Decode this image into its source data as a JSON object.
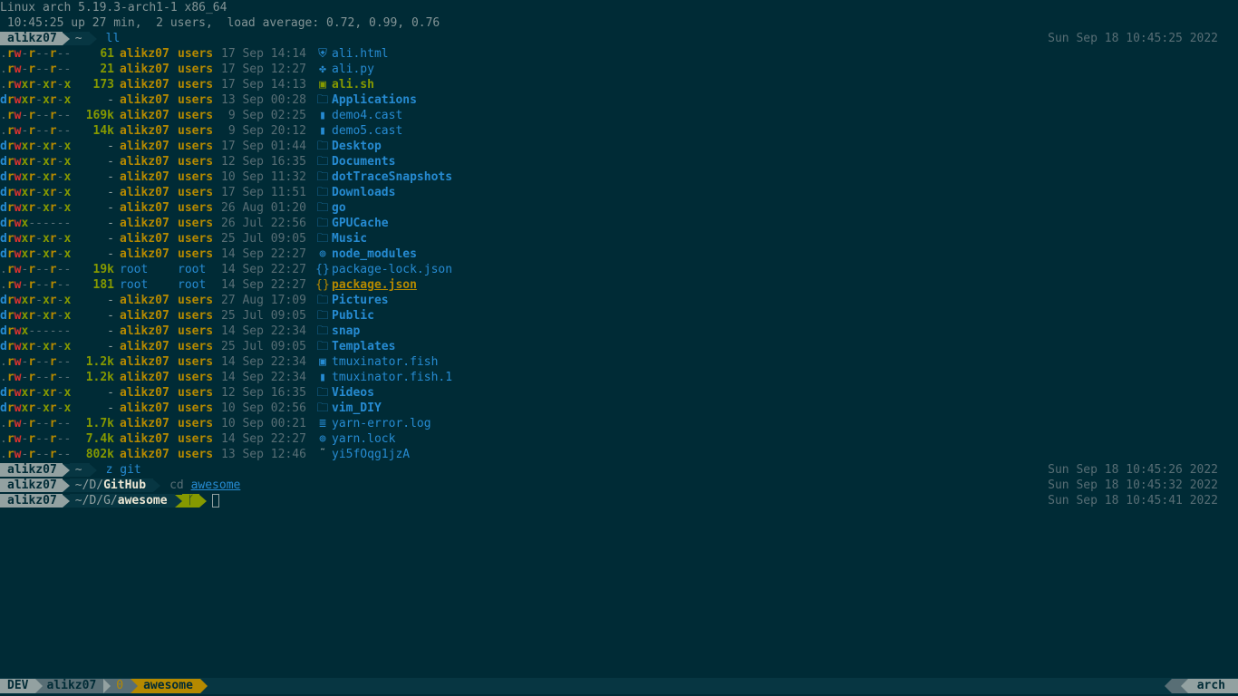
{
  "header": {
    "uname": "Linux arch 5.19.3-arch1-1 x86_64",
    "uptime": " 10:45:25 up 27 min,  2 users,  load average: 0.72, 0.99, 0.76"
  },
  "prompts": [
    {
      "user": "alikz07",
      "path_pre": "~",
      "path_bold": "",
      "command": "ll",
      "arg": "",
      "timestamp": "Sun Sep 18 10:45:25 2022"
    },
    {
      "user": "alikz07",
      "path_pre": "~",
      "path_bold": "",
      "command": "z git",
      "arg": "",
      "timestamp": "Sun Sep 18 10:45:26 2022"
    },
    {
      "user": "alikz07",
      "path_pre": "~/D/",
      "path_bold": "GitHub",
      "command": "cd",
      "arg": "awesome",
      "timestamp": "Sun Sep 18 10:45:32 2022"
    },
    {
      "user": "alikz07",
      "path_pre": "~/D/G/",
      "path_bold": "awesome",
      "command": "",
      "arg": "",
      "git_icon": "ᚴ",
      "timestamp": "Sun Sep 18 10:45:41 2022"
    }
  ],
  "files": [
    {
      "perm": ".rw-r--r--",
      "size": "61",
      "user": "alikz07",
      "group": "users",
      "date": "17 Sep 14:14",
      "icon": "html-icon",
      "glyph": "⛨",
      "name": "ali.html",
      "kind": "file"
    },
    {
      "perm": ".rw-r--r--",
      "size": "21",
      "user": "alikz07",
      "group": "users",
      "date": "17 Sep 12:27",
      "icon": "python-icon",
      "glyph": "✤",
      "name": "ali.py",
      "kind": "file"
    },
    {
      "perm": ".rwxr-xr-x",
      "size": "173",
      "user": "alikz07",
      "group": "users",
      "date": "17 Sep 14:13",
      "icon": "terminal-icon",
      "glyph": "▣",
      "name": "ali.sh",
      "kind": "exe"
    },
    {
      "perm": "drwxr-xr-x",
      "size": "-",
      "user": "alikz07",
      "group": "users",
      "date": "13 Sep 00:28",
      "icon": "folder-icon",
      "glyph": "🗀",
      "name": "Applications",
      "kind": "dir"
    },
    {
      "perm": ".rw-r--r--",
      "size": "169k",
      "user": "alikz07",
      "group": "users",
      "date": " 9 Sep 02:25",
      "icon": "file-icon",
      "glyph": "▮",
      "name": "demo4.cast",
      "kind": "file"
    },
    {
      "perm": ".rw-r--r--",
      "size": "14k",
      "user": "alikz07",
      "group": "users",
      "date": " 9 Sep 20:12",
      "icon": "file-icon",
      "glyph": "▮",
      "name": "demo5.cast",
      "kind": "file"
    },
    {
      "perm": "drwxr-xr-x",
      "size": "-",
      "user": "alikz07",
      "group": "users",
      "date": "17 Sep 01:44",
      "icon": "folder-icon",
      "glyph": "🗀",
      "name": "Desktop",
      "kind": "dir"
    },
    {
      "perm": "drwxr-xr-x",
      "size": "-",
      "user": "alikz07",
      "group": "users",
      "date": "12 Sep 16:35",
      "icon": "folder-icon",
      "glyph": "🗀",
      "name": "Documents",
      "kind": "dir"
    },
    {
      "perm": "drwxr-xr-x",
      "size": "-",
      "user": "alikz07",
      "group": "users",
      "date": "10 Sep 11:32",
      "icon": "folder-icon",
      "glyph": "🗀",
      "name": "dotTraceSnapshots",
      "kind": "dir"
    },
    {
      "perm": "drwxr-xr-x",
      "size": "-",
      "user": "alikz07",
      "group": "users",
      "date": "17 Sep 11:51",
      "icon": "folder-icon",
      "glyph": "🗀",
      "name": "Downloads",
      "kind": "dir"
    },
    {
      "perm": "drwxr-xr-x",
      "size": "-",
      "user": "alikz07",
      "group": "users",
      "date": "26 Aug 01:20",
      "icon": "folder-icon",
      "glyph": "🗀",
      "name": "go",
      "kind": "dir"
    },
    {
      "perm": "drwx------",
      "size": "-",
      "user": "alikz07",
      "group": "users",
      "date": "26 Jul 22:56",
      "icon": "folder-icon",
      "glyph": "🗀",
      "name": "GPUCache",
      "kind": "dir"
    },
    {
      "perm": "drwxr-xr-x",
      "size": "-",
      "user": "alikz07",
      "group": "users",
      "date": "25 Jul 09:05",
      "icon": "folder-icon",
      "glyph": "🗀",
      "name": "Music",
      "kind": "dir"
    },
    {
      "perm": "drwxr-xr-x",
      "size": "-",
      "user": "alikz07",
      "group": "users",
      "date": "14 Sep 22:27",
      "icon": "node-icon",
      "glyph": "⊚",
      "name": "node_modules",
      "kind": "dir"
    },
    {
      "perm": ".rw-r--r--",
      "size": "19k",
      "user": "root",
      "group": "root",
      "date": "14 Sep 22:27",
      "icon": "json-icon",
      "glyph": "{}",
      "name": "package-lock.json",
      "kind": "file"
    },
    {
      "perm": ".rw-r--r--",
      "size": "181",
      "user": "root",
      "group": "root",
      "date": "14 Sep 22:27",
      "icon": "json-icon",
      "glyph": "{}",
      "name": "package.json",
      "kind": "hl"
    },
    {
      "perm": "drwxr-xr-x",
      "size": "-",
      "user": "alikz07",
      "group": "users",
      "date": "27 Aug 17:09",
      "icon": "folder-icon",
      "glyph": "🗀",
      "name": "Pictures",
      "kind": "dir"
    },
    {
      "perm": "drwxr-xr-x",
      "size": "-",
      "user": "alikz07",
      "group": "users",
      "date": "25 Jul 09:05",
      "icon": "folder-icon",
      "glyph": "🗀",
      "name": "Public",
      "kind": "dir"
    },
    {
      "perm": "drwx------",
      "size": "-",
      "user": "alikz07",
      "group": "users",
      "date": "14 Sep 22:34",
      "icon": "folder-icon",
      "glyph": "🗀",
      "name": "snap",
      "kind": "dir"
    },
    {
      "perm": "drwxr-xr-x",
      "size": "-",
      "user": "alikz07",
      "group": "users",
      "date": "25 Jul 09:05",
      "icon": "folder-icon",
      "glyph": "🗀",
      "name": "Templates",
      "kind": "dir"
    },
    {
      "perm": ".rw-r--r--",
      "size": "1.2k",
      "user": "alikz07",
      "group": "users",
      "date": "14 Sep 22:34",
      "icon": "terminal-icon",
      "glyph": "▣",
      "name": "tmuxinator.fish",
      "kind": "file"
    },
    {
      "perm": ".rw-r--r--",
      "size": "1.2k",
      "user": "alikz07",
      "group": "users",
      "date": "14 Sep 22:34",
      "icon": "file-icon",
      "glyph": "▮",
      "name": "tmuxinator.fish.1",
      "kind": "file"
    },
    {
      "perm": "drwxr-xr-x",
      "size": "-",
      "user": "alikz07",
      "group": "users",
      "date": "12 Sep 16:35",
      "icon": "folder-icon",
      "glyph": "🗀",
      "name": "Videos",
      "kind": "dir"
    },
    {
      "perm": "drwxr-xr-x",
      "size": "-",
      "user": "alikz07",
      "group": "users",
      "date": "10 Sep 02:56",
      "icon": "folder-icon",
      "glyph": "🗀",
      "name": "vim_DIY",
      "kind": "dir"
    },
    {
      "perm": ".rw-r--r--",
      "size": "1.7k",
      "user": "alikz07",
      "group": "users",
      "date": "10 Sep 00:21",
      "icon": "log-icon",
      "glyph": "≣",
      "name": "yarn-error.log",
      "kind": "file"
    },
    {
      "perm": ".rw-r--r--",
      "size": "7.4k",
      "user": "alikz07",
      "group": "users",
      "date": "14 Sep 22:27",
      "icon": "yarn-icon",
      "glyph": "⊚",
      "name": "yarn.lock",
      "kind": "file"
    },
    {
      "perm": ".rw-r--r--",
      "size": "802k",
      "user": "alikz07",
      "group": "users",
      "date": "13 Sep 12:46",
      "icon": "unknown-icon",
      "glyph": "˜",
      "name": "yi5fOqg1jzA",
      "kind": "file"
    }
  ],
  "statusbar": {
    "session": "DEV",
    "user": "alikz07",
    "window_index": "0",
    "window_name": "awesome",
    "host": "arch"
  },
  "colors": {
    "background": "#002b36",
    "accent_yellow": "#b58900",
    "accent_blue": "#268bd2",
    "accent_green": "#859900"
  }
}
